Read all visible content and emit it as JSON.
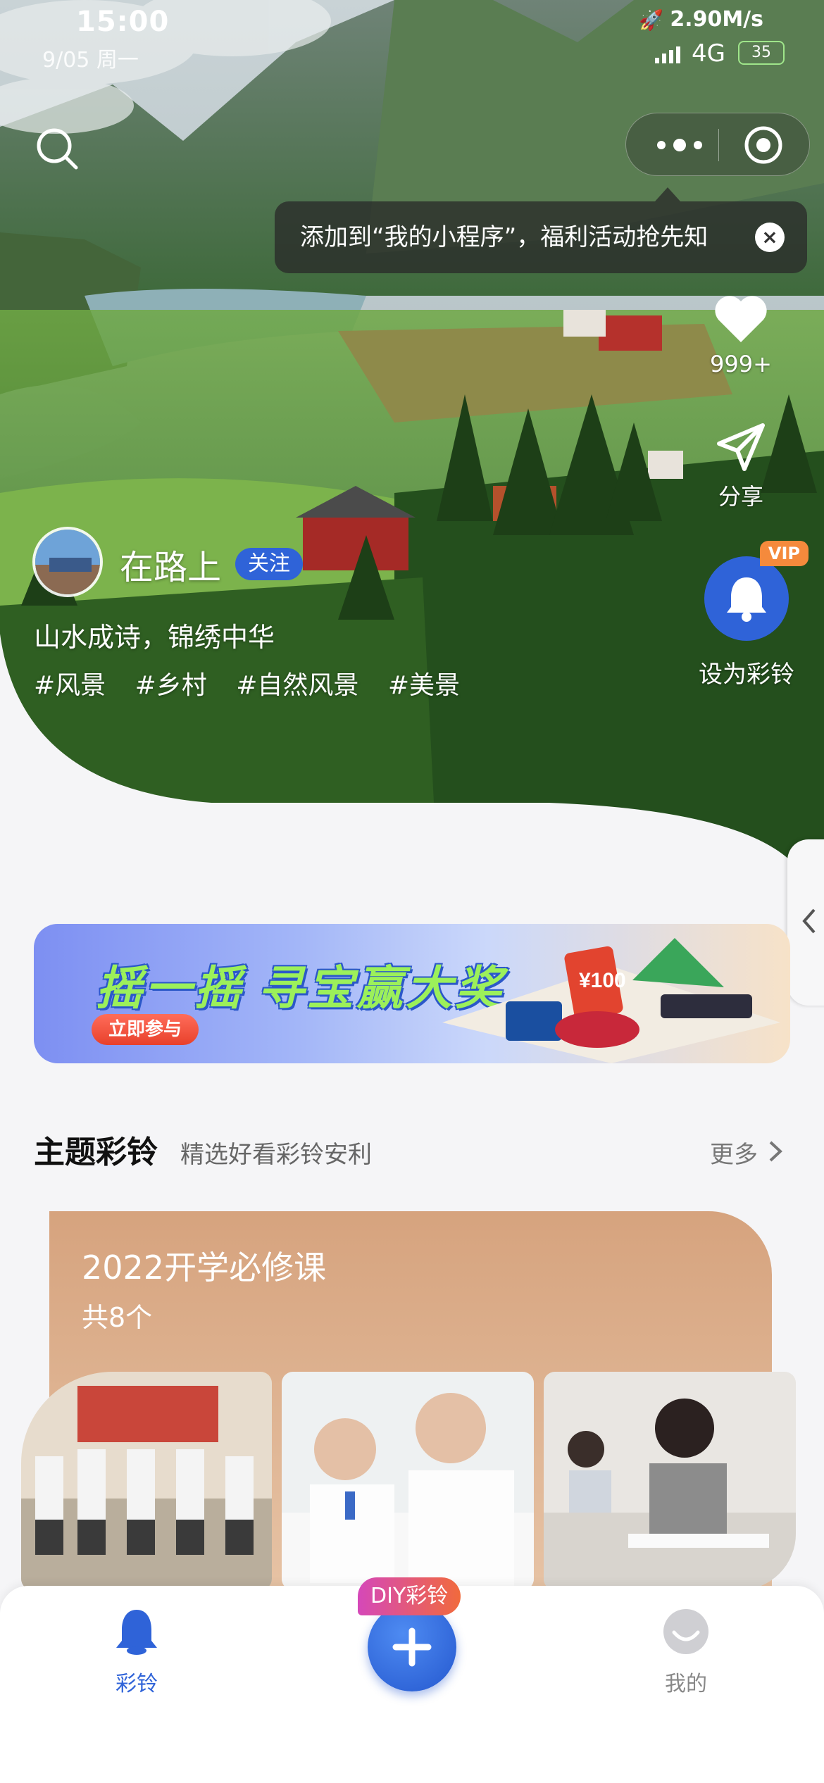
{
  "status_bar": {
    "time": "15:00",
    "date": "9/05 周一",
    "speed": "2.90M/s",
    "network": "4G",
    "battery": "35"
  },
  "top_bar": {
    "search_icon": "search-icon",
    "more_icon": "more-dots-icon",
    "target_icon": "target-icon"
  },
  "tip": {
    "text": "添加到“我的小程序”，福利活动抢先知",
    "close_label": "×"
  },
  "actions": {
    "like_count": "999+",
    "share_label": "分享",
    "set_ring_label": "设为彩铃",
    "vip_label": "VIP"
  },
  "author": {
    "name": "在路上",
    "follow_label": "关注"
  },
  "video": {
    "description": "山水成诗，锦绣中华",
    "tags": [
      "#风景",
      "#乡村",
      "#自然风景",
      "#美景"
    ]
  },
  "banner": {
    "title_part1": "摇一摇",
    "title_part2": "寻宝赢大奖",
    "cta": "立即参与",
    "price_tag": "¥100"
  },
  "section": {
    "title": "主题彩铃",
    "subtitle": "精选好看彩铃安利",
    "more": "更多"
  },
  "collection": {
    "title": "2022开学必修课",
    "count": "共8个"
  },
  "tabbar": {
    "ring_label": "彩铃",
    "diy_label": "DIY彩铃",
    "mine_label": "我的"
  },
  "colors": {
    "accent": "#2f63d8",
    "vip": "#f58a3c",
    "card": "#d6a37e"
  }
}
